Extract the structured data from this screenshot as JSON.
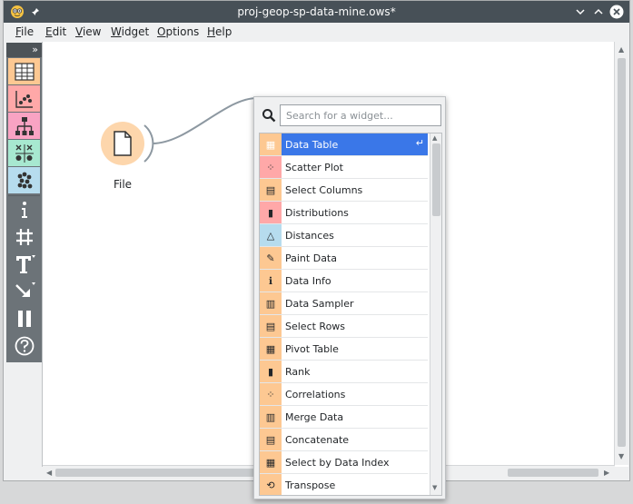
{
  "window": {
    "title": "proj-geop-sp-data-mine.ows*"
  },
  "menu": [
    "File",
    "Edit",
    "View",
    "Widget",
    "Options",
    "Help"
  ],
  "toolbox": {
    "expand": "»",
    "categories": [
      "data-icon",
      "visualize-icon",
      "model-icon",
      "evaluate-icon",
      "unsupervised-icon"
    ],
    "tools": [
      "info-icon",
      "grid-icon",
      "text-annotation-icon",
      "arrow-annotation-icon",
      "pause-icon",
      "help-icon"
    ]
  },
  "canvas": {
    "node_label": "File"
  },
  "popup": {
    "search_placeholder": "Search for a widget...",
    "items": [
      "Data Table",
      "Scatter Plot",
      "Select Columns",
      "Distributions",
      "Distances",
      "Paint Data",
      "Data Info",
      "Data Sampler",
      "Select Rows",
      "Pivot Table",
      "Rank",
      "Correlations",
      "Merge Data",
      "Concatenate",
      "Select by Data Index",
      "Transpose"
    ],
    "selected_index": 0,
    "enter_glyph": "↵"
  },
  "colors": {
    "titlebar": "#475057",
    "selection": "#3a77e8",
    "data_category": "#fdc892",
    "visualize_category": "#ffa8a8",
    "model_category": "#f9a3c3",
    "evaluate_category": "#a7e8d0",
    "unsupervised_category": "#b6dcee"
  }
}
